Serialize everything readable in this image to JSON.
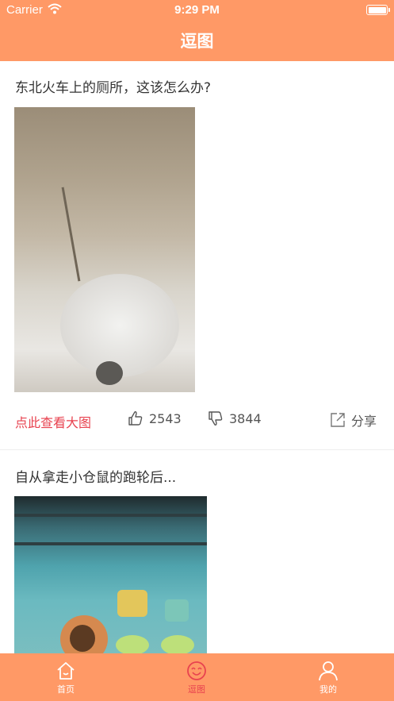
{
  "status_bar": {
    "carrier": "Carrier",
    "time": "9:29 PM"
  },
  "header": {
    "title": "逗图"
  },
  "feed": {
    "posts": [
      {
        "title": "东北火车上的厕所，这该怎么办?",
        "view_large_label": "点此查看大图",
        "likes": "2543",
        "dislikes": "3844",
        "share_label": "分享"
      },
      {
        "title": "自从拿走小仓鼠的跑轮后..."
      }
    ]
  },
  "tabbar": {
    "items": [
      {
        "label": "首页",
        "icon": "home-icon",
        "active": false
      },
      {
        "label": "逗图",
        "icon": "smiley-icon",
        "active": true
      },
      {
        "label": "我的",
        "icon": "person-icon",
        "active": false
      }
    ]
  },
  "colors": {
    "brand": "#FF9966",
    "accent_red": "#E8424F",
    "text_dark": "#333333",
    "text_gray": "#555555"
  }
}
